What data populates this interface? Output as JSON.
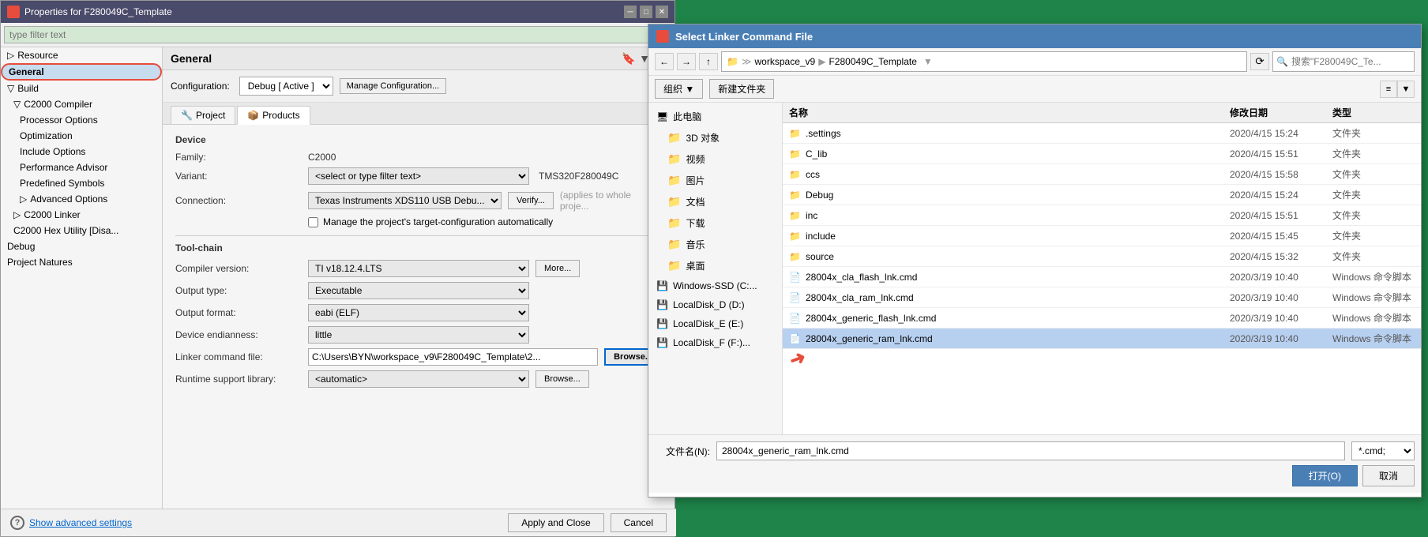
{
  "ide": {
    "title": "Properties for F280049C_Template",
    "filter_placeholder": "type filter text",
    "header": "General",
    "configuration_label": "Configuration:",
    "configuration_value": "Debug  [ Active ]",
    "manage_btn": "Manage Configuration...",
    "tabs": [
      {
        "id": "project",
        "label": "Project",
        "icon": "🔧"
      },
      {
        "id": "products",
        "label": "Products",
        "icon": "📦"
      }
    ],
    "device_section": "Device",
    "family_label": "Family:",
    "family_value": "C2000",
    "variant_label": "Variant:",
    "variant_placeholder": "<select or type filter text>",
    "variant_value": "TMS320F280049C",
    "connection_label": "Connection:",
    "connection_value": "Texas Instruments XDS110 USB Debu...",
    "verify_btn": "Verify...",
    "verify_note": "(applies to whole proje...",
    "auto_config_label": "Manage the project's target-configuration automatically",
    "toolchain_section": "Tool-chain",
    "compiler_version_label": "Compiler version:",
    "compiler_version_value": "TI v18.12.4.LTS",
    "more_btn": "More...",
    "output_type_label": "Output type:",
    "output_type_value": "Executable",
    "output_format_label": "Output format:",
    "output_format_value": "eabi (ELF)",
    "device_endianness_label": "Device endianness:",
    "device_endianness_value": "little",
    "linker_cmd_label": "Linker command file:",
    "linker_cmd_value": "C:\\Users\\BYN\\workspace_v9\\F280049C_Template\\2...",
    "browse_btn1": "Browse...",
    "runtime_lib_label": "Runtime support library:",
    "runtime_lib_value": "<automatic>",
    "browse_btn2": "Browse...",
    "show_advanced": "Show advanced settings",
    "apply_close_btn": "Apply and Close",
    "cancel_btn": "Cancel"
  },
  "sidebar": {
    "items": [
      {
        "id": "resource",
        "label": "Resource",
        "level": 1,
        "expandable": true
      },
      {
        "id": "general",
        "label": "General",
        "level": 1,
        "selected": true,
        "highlighted": true
      },
      {
        "id": "build",
        "label": "Build",
        "level": 1,
        "expandable": true
      },
      {
        "id": "c2000-compiler",
        "label": "C2000 Compiler",
        "level": 2,
        "expandable": true
      },
      {
        "id": "processor-options",
        "label": "Processor Options",
        "level": 3
      },
      {
        "id": "optimization",
        "label": "Optimization",
        "level": 3
      },
      {
        "id": "include-options",
        "label": "Include Options",
        "level": 3
      },
      {
        "id": "performance-advisor",
        "label": "Performance Advisor",
        "level": 3
      },
      {
        "id": "predefined-symbols",
        "label": "Predefined Symbols",
        "level": 3
      },
      {
        "id": "advanced-options",
        "label": "Advanced Options",
        "level": 3,
        "expandable": true
      },
      {
        "id": "c2000-linker",
        "label": "C2000 Linker",
        "level": 2,
        "expandable": true
      },
      {
        "id": "c2000-hex",
        "label": "C2000 Hex Utility [Disa...",
        "level": 2
      },
      {
        "id": "debug",
        "label": "Debug",
        "level": 1
      },
      {
        "id": "project-natures",
        "label": "Project Natures",
        "level": 1
      }
    ]
  },
  "file_dialog": {
    "title": "Select Linker Command File",
    "breadcrumb": {
      "parts": [
        "workspace_v9",
        "F280049C_Template"
      ]
    },
    "search_placeholder": "搜索\"F280049C_Te...",
    "action_bar": {
      "organize": "组织 ▼",
      "new_folder": "新建文件夹"
    },
    "left_panel": {
      "items": [
        {
          "id": "this-pc",
          "label": "此电脑",
          "icon": "computer"
        },
        {
          "id": "3d-objects",
          "label": "3D 对象",
          "icon": "folder",
          "indent": true
        },
        {
          "id": "video",
          "label": "视频",
          "icon": "folder",
          "indent": true
        },
        {
          "id": "pictures",
          "label": "图片",
          "icon": "folder",
          "indent": true
        },
        {
          "id": "documents",
          "label": "文档",
          "icon": "folder",
          "indent": true
        },
        {
          "id": "downloads",
          "label": "下载",
          "icon": "folder",
          "indent": true
        },
        {
          "id": "music",
          "label": "音乐",
          "icon": "folder",
          "indent": true
        },
        {
          "id": "desktop",
          "label": "桌面",
          "icon": "folder",
          "indent": true
        },
        {
          "id": "windows-ssd",
          "label": "Windows-SSD (C:...",
          "icon": "disk"
        },
        {
          "id": "local-d",
          "label": "LocalDisk_D (D:)",
          "icon": "disk"
        },
        {
          "id": "local-e",
          "label": "LocalDisk_E (E:)",
          "icon": "disk"
        },
        {
          "id": "local-f",
          "label": "LocalDisk_F (F:)...",
          "icon": "disk"
        }
      ]
    },
    "columns": {
      "name": "名称",
      "date": "修改日期",
      "type": "类型"
    },
    "files": [
      {
        "id": "settings",
        "name": ".settings",
        "date": "2020/4/15 15:24",
        "type": "文件夹",
        "is_folder": true
      },
      {
        "id": "c-lib",
        "name": "C_lib",
        "date": "2020/4/15 15:51",
        "type": "文件夹",
        "is_folder": true
      },
      {
        "id": "ccs",
        "name": "ccs",
        "date": "2020/4/15 15:58",
        "type": "文件夹",
        "is_folder": true
      },
      {
        "id": "debug-folder",
        "name": "Debug",
        "date": "2020/4/15 15:24",
        "type": "文件夹",
        "is_folder": true
      },
      {
        "id": "inc",
        "name": "inc",
        "date": "2020/4/15 15:51",
        "type": "文件夹",
        "is_folder": true
      },
      {
        "id": "include",
        "name": "include",
        "date": "2020/4/15 15:45",
        "type": "文件夹",
        "is_folder": true
      },
      {
        "id": "source",
        "name": "source",
        "date": "2020/4/15 15:32",
        "type": "文件夹",
        "is_folder": true
      },
      {
        "id": "cla-flash",
        "name": "28004x_cla_flash_lnk.cmd",
        "date": "2020/3/19 10:40",
        "type": "Windows 命令脚本",
        "is_folder": false
      },
      {
        "id": "cla-ram",
        "name": "28004x_cla_ram_lnk.cmd",
        "date": "2020/3/19 10:40",
        "type": "Windows 命令脚本",
        "is_folder": false
      },
      {
        "id": "generic-flash",
        "name": "28004x_generic_flash_lnk.cmd",
        "date": "2020/3/19 10:40",
        "type": "Windows 命令脚本",
        "is_folder": false
      },
      {
        "id": "generic-ram",
        "name": "28004x_generic_ram_lnk.cmd",
        "date": "2020/3/19 10:40",
        "type": "Windows 命令脚本",
        "is_folder": false,
        "selected": true
      }
    ],
    "filename_label": "文件名(N):",
    "filename_value": "28004x_generic_ram_lnk.cmd",
    "filetype_value": "*.cmd;",
    "open_btn": "打开(O)",
    "cancel_btn": "取消"
  }
}
